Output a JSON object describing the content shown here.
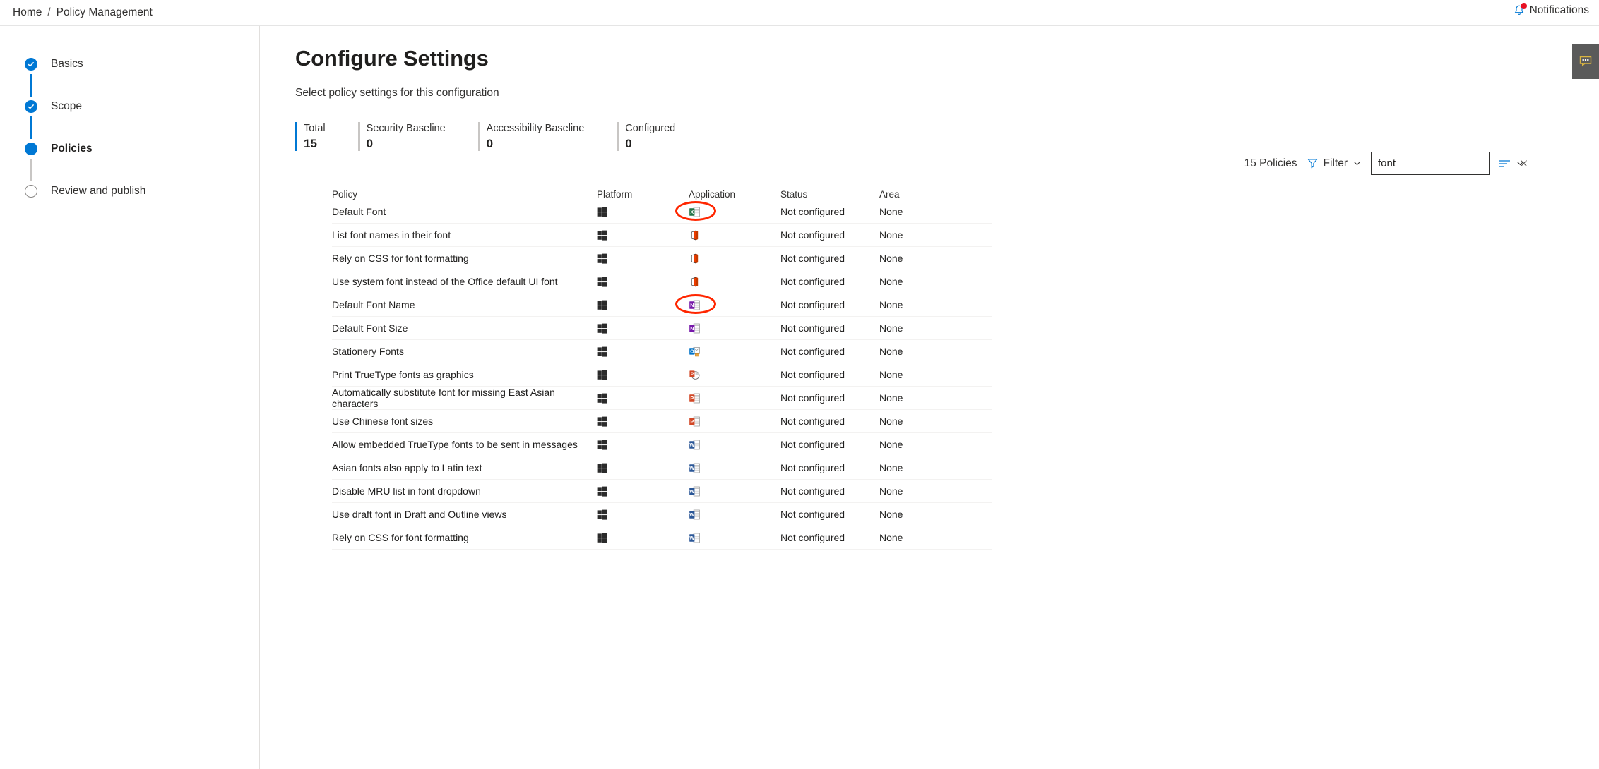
{
  "breadcrumb": {
    "home": "Home",
    "separator": "/",
    "current": "Policy Management"
  },
  "notifications": {
    "label": "Notifications",
    "icon": "bell-icon",
    "badge_color": "#e81123"
  },
  "feedback": {
    "icon": "feedback-chat-icon"
  },
  "wizard": {
    "steps": [
      {
        "label": "Basics",
        "state": "done"
      },
      {
        "label": "Scope",
        "state": "done"
      },
      {
        "label": "Policies",
        "state": "current"
      },
      {
        "label": "Review and publish",
        "state": "todo"
      }
    ]
  },
  "page": {
    "title": "Configure Settings",
    "subtitle": "Select policy settings for this configuration"
  },
  "stats": [
    {
      "label": "Total",
      "value": "15",
      "accent": "#0078d4"
    },
    {
      "label": "Security Baseline",
      "value": "0",
      "accent": "#c8c6c4"
    },
    {
      "label": "Accessibility Baseline",
      "value": "0",
      "accent": "#c8c6c4"
    },
    {
      "label": "Configured",
      "value": "0",
      "accent": "#c8c6c4"
    }
  ],
  "toolbar": {
    "policy_count": "15 Policies",
    "filter_label": "Filter",
    "filter_icon": "funnel-icon",
    "search_value": "font",
    "search_placeholder": "Search",
    "clear_icon": "close-icon",
    "sort_icon": "sort-lines-icon",
    "accent": "#0078d4"
  },
  "table": {
    "columns": [
      "Policy",
      "Platform",
      "Application",
      "Status",
      "Area"
    ],
    "rows": [
      {
        "policy": "Default Font",
        "platform": "windows-icon",
        "app": "excel-icon",
        "status": "Not configured",
        "area": "None",
        "highlight": true
      },
      {
        "policy": "List font names in their font",
        "platform": "windows-icon",
        "app": "office-icon",
        "status": "Not configured",
        "area": "None",
        "highlight": false
      },
      {
        "policy": "Rely on CSS for font formatting",
        "platform": "windows-icon",
        "app": "office-icon",
        "status": "Not configured",
        "area": "None",
        "highlight": false
      },
      {
        "policy": "Use system font instead of the Office default UI font",
        "platform": "windows-icon",
        "app": "office-icon",
        "status": "Not configured",
        "area": "None",
        "highlight": false
      },
      {
        "policy": "Default Font Name",
        "platform": "windows-icon",
        "app": "onenote-icon",
        "status": "Not configured",
        "area": "None",
        "highlight": true
      },
      {
        "policy": "Default Font Size",
        "platform": "windows-icon",
        "app": "onenote-icon",
        "status": "Not configured",
        "area": "None",
        "highlight": false
      },
      {
        "policy": "Stationery Fonts",
        "platform": "windows-icon",
        "app": "outlook-icon",
        "status": "Not configured",
        "area": "None",
        "highlight": false
      },
      {
        "policy": "Print TrueType fonts as graphics",
        "platform": "windows-icon",
        "app": "powerpoint-round-icon",
        "status": "Not configured",
        "area": "None",
        "highlight": false
      },
      {
        "policy": "Automatically substitute font for missing East Asian characters",
        "platform": "windows-icon",
        "app": "powerpoint-icon",
        "status": "Not configured",
        "area": "None",
        "highlight": false
      },
      {
        "policy": "Use Chinese font sizes",
        "platform": "windows-icon",
        "app": "powerpoint-icon",
        "status": "Not configured",
        "area": "None",
        "highlight": false
      },
      {
        "policy": "Allow embedded TrueType fonts to be sent in messages",
        "platform": "windows-icon",
        "app": "word-icon",
        "status": "Not configured",
        "area": "None",
        "highlight": false
      },
      {
        "policy": "Asian fonts also apply to Latin text",
        "platform": "windows-icon",
        "app": "word-icon",
        "status": "Not configured",
        "area": "None",
        "highlight": false
      },
      {
        "policy": "Disable MRU list in font dropdown",
        "platform": "windows-icon",
        "app": "word-icon",
        "status": "Not configured",
        "area": "None",
        "highlight": false
      },
      {
        "policy": "Use draft font in Draft and Outline views",
        "platform": "windows-icon",
        "app": "word-icon",
        "status": "Not configured",
        "area": "None",
        "highlight": false
      },
      {
        "policy": "Rely on CSS for font formatting",
        "platform": "windows-icon",
        "app": "word-icon",
        "status": "Not configured",
        "area": "None",
        "highlight": false
      }
    ]
  }
}
